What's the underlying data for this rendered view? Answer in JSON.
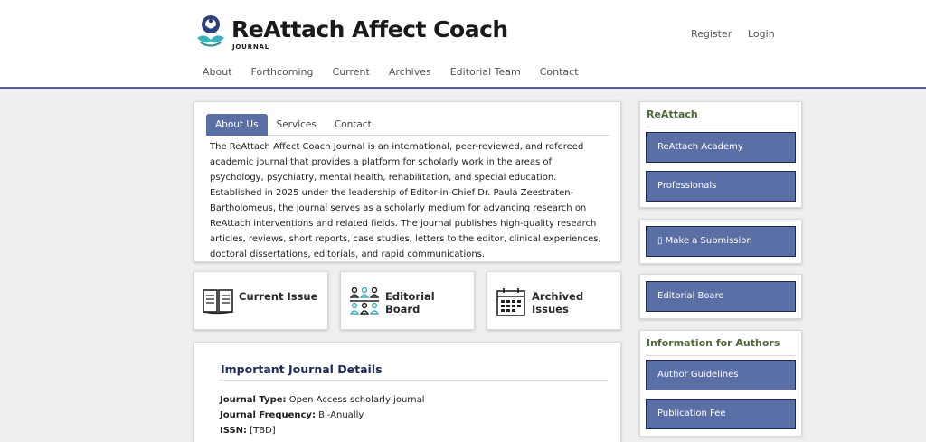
{
  "header": {
    "title": "ReAttach Affect Coach",
    "subtitle": "JOURNAL",
    "logo_icon": "reattach-logo-icon",
    "user_nav": [
      "Register",
      "Login"
    ],
    "nav": [
      "About",
      "Forthcoming",
      "Current",
      "Archives",
      "Editorial Team",
      "Contact"
    ]
  },
  "about": {
    "tabs": [
      "About Us",
      "Services",
      "Contact"
    ],
    "active_tab": "About Us",
    "text": "The ReAttach Affect Coach Journal is an international, peer-reviewed, and refereed academic journal that provides a platform for scholarly work in the areas of psychology, psychiatry, mental health, rehabilitation, and special education. Established in 2025 under the leadership of Editor-in-Chief Dr. Paula Zeestraten-Bartholomeus, the journal serves as a scholarly medium for advancing research on ReAttach interventions and related fields. The journal publishes high-quality research articles, reviews, short reports, case studies, letters to the editor, clinical experiences, doctoral dissertations, editorials, and rapid communications."
  },
  "quick_links": [
    {
      "line1": "Current Issue",
      "line2": "",
      "icon": "open-book-icon"
    },
    {
      "line1": "Editorial",
      "line2": "Board",
      "icon": "people-group-icon"
    },
    {
      "line1": "Archived",
      "line2": "Issues",
      "icon": "calendar-icon"
    }
  ],
  "details": {
    "title": "Important Journal Details",
    "rows": [
      {
        "label": "Journal Type:",
        "value": "Open Access scholarly journal"
      },
      {
        "label": "Journal Frequency:",
        "value": "Bi-Anually"
      },
      {
        "label": "ISSN:",
        "value": "[TBD]"
      }
    ]
  },
  "sidebar": {
    "reattach": {
      "title": "ReAttach",
      "buttons": [
        "ReAttach Academy",
        "Professionals"
      ]
    },
    "submission": {
      "button": "▯ Make a Submission"
    },
    "editorial": {
      "button": "Editorial Board"
    },
    "authors": {
      "title": "Information for Authors",
      "buttons": [
        "Author Guidelines",
        "Publication Fee"
      ]
    }
  },
  "colors": {
    "accent": "#5a6fa5",
    "header_rule": "#5a6190",
    "sidebar_title": "#4f6a3a",
    "details_title": "#1f2a5a"
  }
}
